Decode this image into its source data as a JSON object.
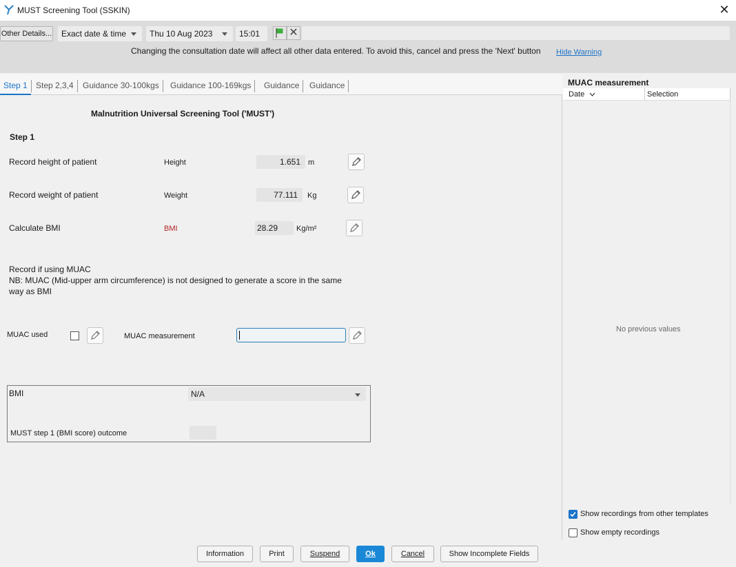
{
  "window": {
    "title": "MUST Screening Tool (SSKIN)"
  },
  "toolbar": {
    "other_details_label": "Other Details...",
    "date_mode": "Exact date & time",
    "date_value": "Thu 10 Aug 2023",
    "time_value": "15:01",
    "warning_text": "Changing the consultation date will affect all other data entered. To avoid this, cancel and press the 'Next' button",
    "hide_warning_label": "Hide Warning"
  },
  "tabs": [
    {
      "label": "Step 1",
      "active": true
    },
    {
      "label": "Step 2,3,4",
      "active": false
    },
    {
      "label": "Guidance 30-100kgs",
      "active": false
    },
    {
      "label": "Guidance 100-169kgs",
      "active": false
    },
    {
      "label": "Guidance",
      "active": false
    },
    {
      "label": "Guidance",
      "active": false
    }
  ],
  "form": {
    "title": "Malnutrition Universal Screening Tool ('MUST')",
    "section_title": "Step 1",
    "height": {
      "prompt": "Record height of patient",
      "label": "Height",
      "value": "1.651",
      "unit": "m"
    },
    "weight": {
      "prompt": "Record weight of patient",
      "label": "Weight",
      "value": "77.111",
      "unit": "Kg"
    },
    "bmi": {
      "prompt": "Calculate BMI",
      "label": "BMI",
      "value": "28.29",
      "unit": "Kg/m²"
    },
    "muac_prompt": "Record if using MUAC",
    "muac_note_line1": "NB: MUAC (Mid-upper arm circumference) is not designed to generate a score in the same",
    "muac_note_line2": "way as BMI",
    "muac_used_label": "MUAC used",
    "muac_measurement_label": "MUAC measurement",
    "muac_measurement_value": ""
  },
  "bmi_group": {
    "label": "BMI",
    "dropdown_value": "N/A",
    "outcome_label": "MUST step 1 (BMI score) outcome",
    "outcome_value": ""
  },
  "side_panel": {
    "title": "MUAC measurement",
    "col_date": "Date",
    "col_selection": "Selection",
    "empty_text": "No previous values",
    "show_other_templates_label": "Show recordings from other templates",
    "show_other_templates_checked": true,
    "show_empty_label": "Show empty recordings",
    "show_empty_checked": false
  },
  "footer": {
    "information_label": "Information",
    "print_label": "Print",
    "suspend_label": "Suspend",
    "ok_label": "Ok",
    "cancel_label": "Cancel",
    "show_incomplete_label": "Show Incomplete Fields"
  },
  "colors": {
    "accent": "#1a73c9",
    "primary_button": "#1a88d6",
    "bmi_label": "#b22222",
    "flag": "#3cae3c"
  }
}
